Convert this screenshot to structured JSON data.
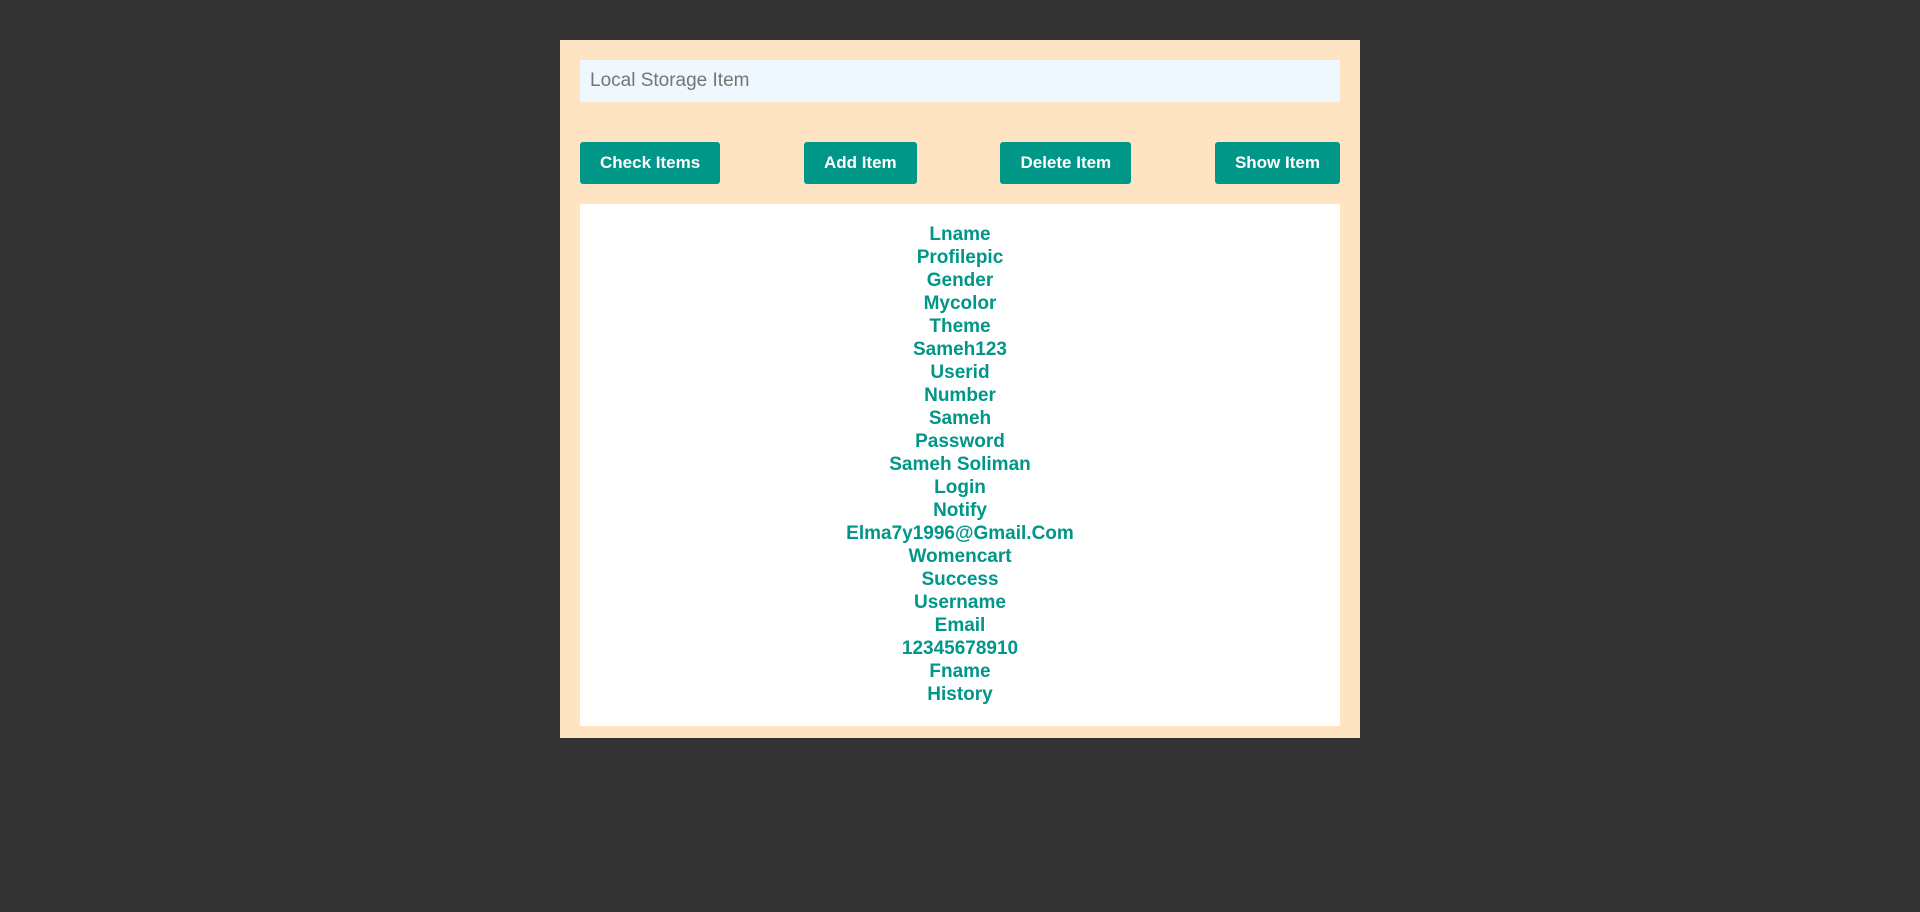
{
  "search": {
    "placeholder": "Local Storage Item",
    "value": ""
  },
  "buttons": {
    "check": "Check Items",
    "add": "Add Item",
    "delete": "Delete Item",
    "show": "Show Item"
  },
  "results": [
    "Lname",
    "Profilepic",
    "Gender",
    "Mycolor",
    "Theme",
    "Sameh123",
    "Userid",
    "Number",
    "Sameh",
    "Password",
    "Sameh Soliman",
    "Login",
    "Notify",
    "Elma7y1996@Gmail.Com",
    "Womencart",
    "Success",
    "Username",
    "Email",
    "12345678910",
    "Fname",
    "History"
  ],
  "colors": {
    "page_background": "#333333",
    "panel_background": "#ffe4c4",
    "input_background": "#f0f8ff",
    "accent": "#009688",
    "results_background": "#ffffff"
  }
}
